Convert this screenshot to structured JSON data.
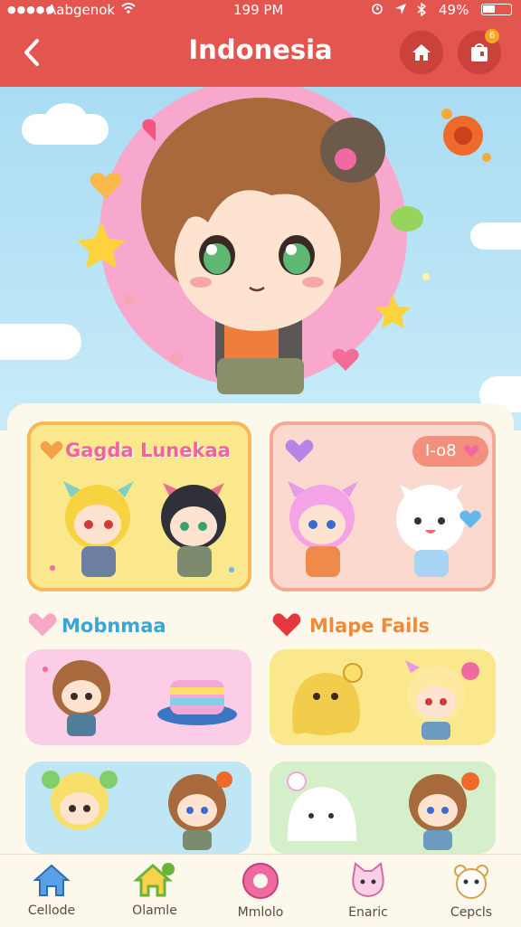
{
  "status_bar": {
    "signal": "●●●●●",
    "carrier": "Aabgenok",
    "time": "199 PM",
    "battery": "49%"
  },
  "header": {
    "title": "Indonesia",
    "back_icon": "chevron-left-icon",
    "bag_badge": "6"
  },
  "cards": {
    "featured_left_title": "Gagda Lunekaa",
    "featured_right_badge": "I-o8",
    "section_left_title": "Mobnmaa",
    "section_right_title": "Mlape Fails"
  },
  "colors": {
    "brand": "#e2564f",
    "sky": "#a9dcf3",
    "card_yellow": "#fbe88c",
    "card_peach": "#fbd9cf",
    "card_pink": "#fbcde6",
    "card_blue": "#bfe6f5",
    "card_green": "#d4efc9"
  },
  "bottom_nav": [
    {
      "label": "Cellode",
      "icon": "house-icon"
    },
    {
      "label": "Olamle",
      "icon": "green-house-icon"
    },
    {
      "label": "Mmlolo",
      "icon": "donut-icon"
    },
    {
      "label": "Enaric",
      "icon": "cat-icon"
    },
    {
      "label": "Cepcls",
      "icon": "bear-icon"
    }
  ]
}
